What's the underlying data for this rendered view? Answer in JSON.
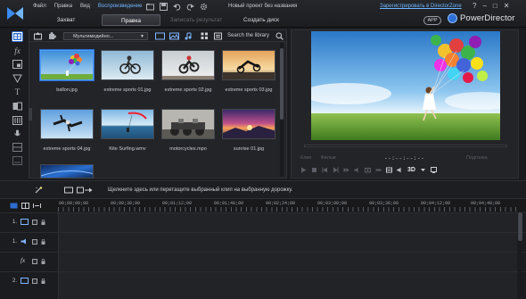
{
  "menu": {
    "items": [
      {
        "label": "Файл",
        "active": false
      },
      {
        "label": "Правка",
        "active": false
      },
      {
        "label": "Вид",
        "active": false
      },
      {
        "label": "Воспроизведение",
        "active": true
      }
    ]
  },
  "header": {
    "project_title": "Новый проект без названия",
    "register_link": "Зарегистрировать в DirectorZone",
    "window_controls": [
      "?",
      "–",
      "□",
      "✕"
    ],
    "tabs": [
      {
        "label": "Захват",
        "state": "normal"
      },
      {
        "label": "Правка",
        "state": "active"
      },
      {
        "label": "Записать результат",
        "state": "disabled"
      },
      {
        "label": "Создать диск",
        "state": "normal"
      }
    ],
    "app_badge": "APP",
    "brand_name": "PowerDirector"
  },
  "library": {
    "dropdown_value": "Мультимедийно...",
    "search_placeholder": "Search the library",
    "items": [
      {
        "label": "ballon.jpg",
        "selected": true,
        "scene": "balloons"
      },
      {
        "label": "extreme sports 01.jpg",
        "selected": false,
        "scene": "bike-sky"
      },
      {
        "label": "extreme sports 02.jpg",
        "selected": false,
        "scene": "moto-jump"
      },
      {
        "label": "extreme sports 03.jpg",
        "selected": false,
        "scene": "sunset-jump"
      },
      {
        "label": "extreme sports 04.jpg",
        "selected": false,
        "scene": "skydive"
      },
      {
        "label": "Kite Surfing.wmv",
        "selected": false,
        "scene": "kite"
      },
      {
        "label": "motorcycles.mpo",
        "selected": false,
        "scene": "motorcycles"
      },
      {
        "label": "sunrise 01.jpg",
        "selected": false,
        "scene": "sunrise"
      },
      {
        "label": "",
        "selected": false,
        "scene": "blue"
      }
    ]
  },
  "preview": {
    "timecode": "--:--:--:--",
    "mode_labels": [
      "Клип",
      "Фильм"
    ],
    "quality_label": "Подгонка"
  },
  "timeline": {
    "hint": "Щелкните здесь или перетащите выбранный клип на выбранную дорожку.",
    "ruler_labels": [
      "00;00;00;00",
      "00;00;38;00",
      "00;01;12;00",
      "00;01;48;00",
      "00;02;24;00",
      "00;03;00;00",
      "00;03;36;00",
      "00;04;12;00",
      "00;04;48;00"
    ],
    "tracks": [
      {
        "number": "1.",
        "kind": "video"
      },
      {
        "number": "1.",
        "kind": "audio"
      },
      {
        "number": "",
        "kind": "fx"
      },
      {
        "number": "2.",
        "kind": "video"
      }
    ]
  },
  "colors": {
    "accent": "#2d6ecf",
    "link": "#6fb6ff",
    "background": "#1b1c1f"
  }
}
